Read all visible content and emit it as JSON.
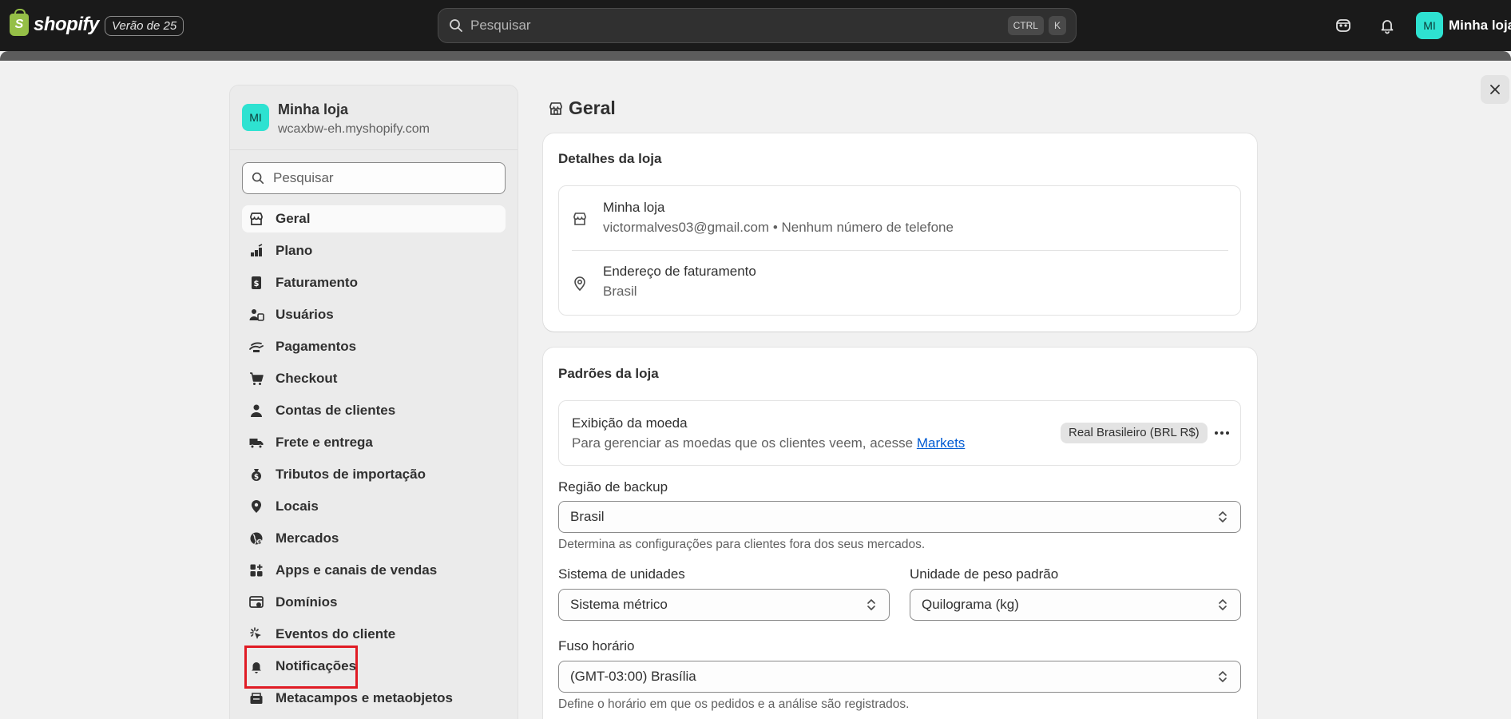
{
  "topbar": {
    "logo_text": "shopify",
    "logo_mark": "S",
    "edition_badge": "Verão de 25",
    "search_placeholder": "Pesquisar",
    "shortcut_keys": [
      "CTRL",
      "K"
    ],
    "avatar_initials": "MI",
    "store_name": "Minha loja"
  },
  "sidebar": {
    "store_initials": "MI",
    "store_name": "Minha loja",
    "store_domain": "wcaxbw-eh.myshopify.com",
    "search_placeholder": "Pesquisar",
    "items": [
      {
        "label": "Geral",
        "icon": "store-icon"
      },
      {
        "label": "Plano",
        "icon": "plan-icon"
      },
      {
        "label": "Faturamento",
        "icon": "billing-icon"
      },
      {
        "label": "Usuários",
        "icon": "users-icon"
      },
      {
        "label": "Pagamentos",
        "icon": "payments-icon"
      },
      {
        "label": "Checkout",
        "icon": "cart-icon"
      },
      {
        "label": "Contas de clientes",
        "icon": "person-icon"
      },
      {
        "label": "Frete e entrega",
        "icon": "truck-icon"
      },
      {
        "label": "Tributos de importação",
        "icon": "duties-icon"
      },
      {
        "label": "Locais",
        "icon": "location-icon"
      },
      {
        "label": "Mercados",
        "icon": "globe-icon"
      },
      {
        "label": "Apps e canais de vendas",
        "icon": "apps-icon"
      },
      {
        "label": "Domínios",
        "icon": "domain-icon"
      },
      {
        "label": "Eventos do cliente",
        "icon": "cursor-click-icon"
      },
      {
        "label": "Notificações",
        "icon": "bell-icon"
      },
      {
        "label": "Metacampos e metaobjetos",
        "icon": "metafields-icon"
      }
    ],
    "active_index": 0,
    "highlighted_index": 14
  },
  "main": {
    "title": "Geral",
    "store_details": {
      "title": "Detalhes da loja",
      "store_name": "Minha loja",
      "contact": "victormalves03@gmail.com • Nenhum número de telefone",
      "billing_label": "Endereço de faturamento",
      "billing_value": "Brasil"
    },
    "defaults": {
      "title": "Padrões da loja",
      "currency_label": "Exibição da moeda",
      "currency_help": "Para gerenciar as moedas que os clientes veem, acesse ",
      "currency_link": "Markets",
      "currency_badge": "Real Brasileiro (BRL R$)",
      "backup_region_label": "Região de backup",
      "backup_region_value": "Brasil",
      "backup_region_help": "Determina as configurações para clientes fora dos seus mercados.",
      "unit_system_label": "Sistema de unidades",
      "unit_system_value": "Sistema métrico",
      "weight_unit_label": "Unidade de peso padrão",
      "weight_unit_value": "Quilograma (kg)",
      "timezone_label": "Fuso horário",
      "timezone_value": "(GMT-03:00) Brasília",
      "timezone_help": "Define o horário em que os pedidos e a análise são registrados."
    }
  },
  "colors": {
    "topbar_bg": "#1a1a1a",
    "accent_teal": "#2ee2d1",
    "link_blue": "#005bd3",
    "highlight_red": "#e01b24"
  }
}
